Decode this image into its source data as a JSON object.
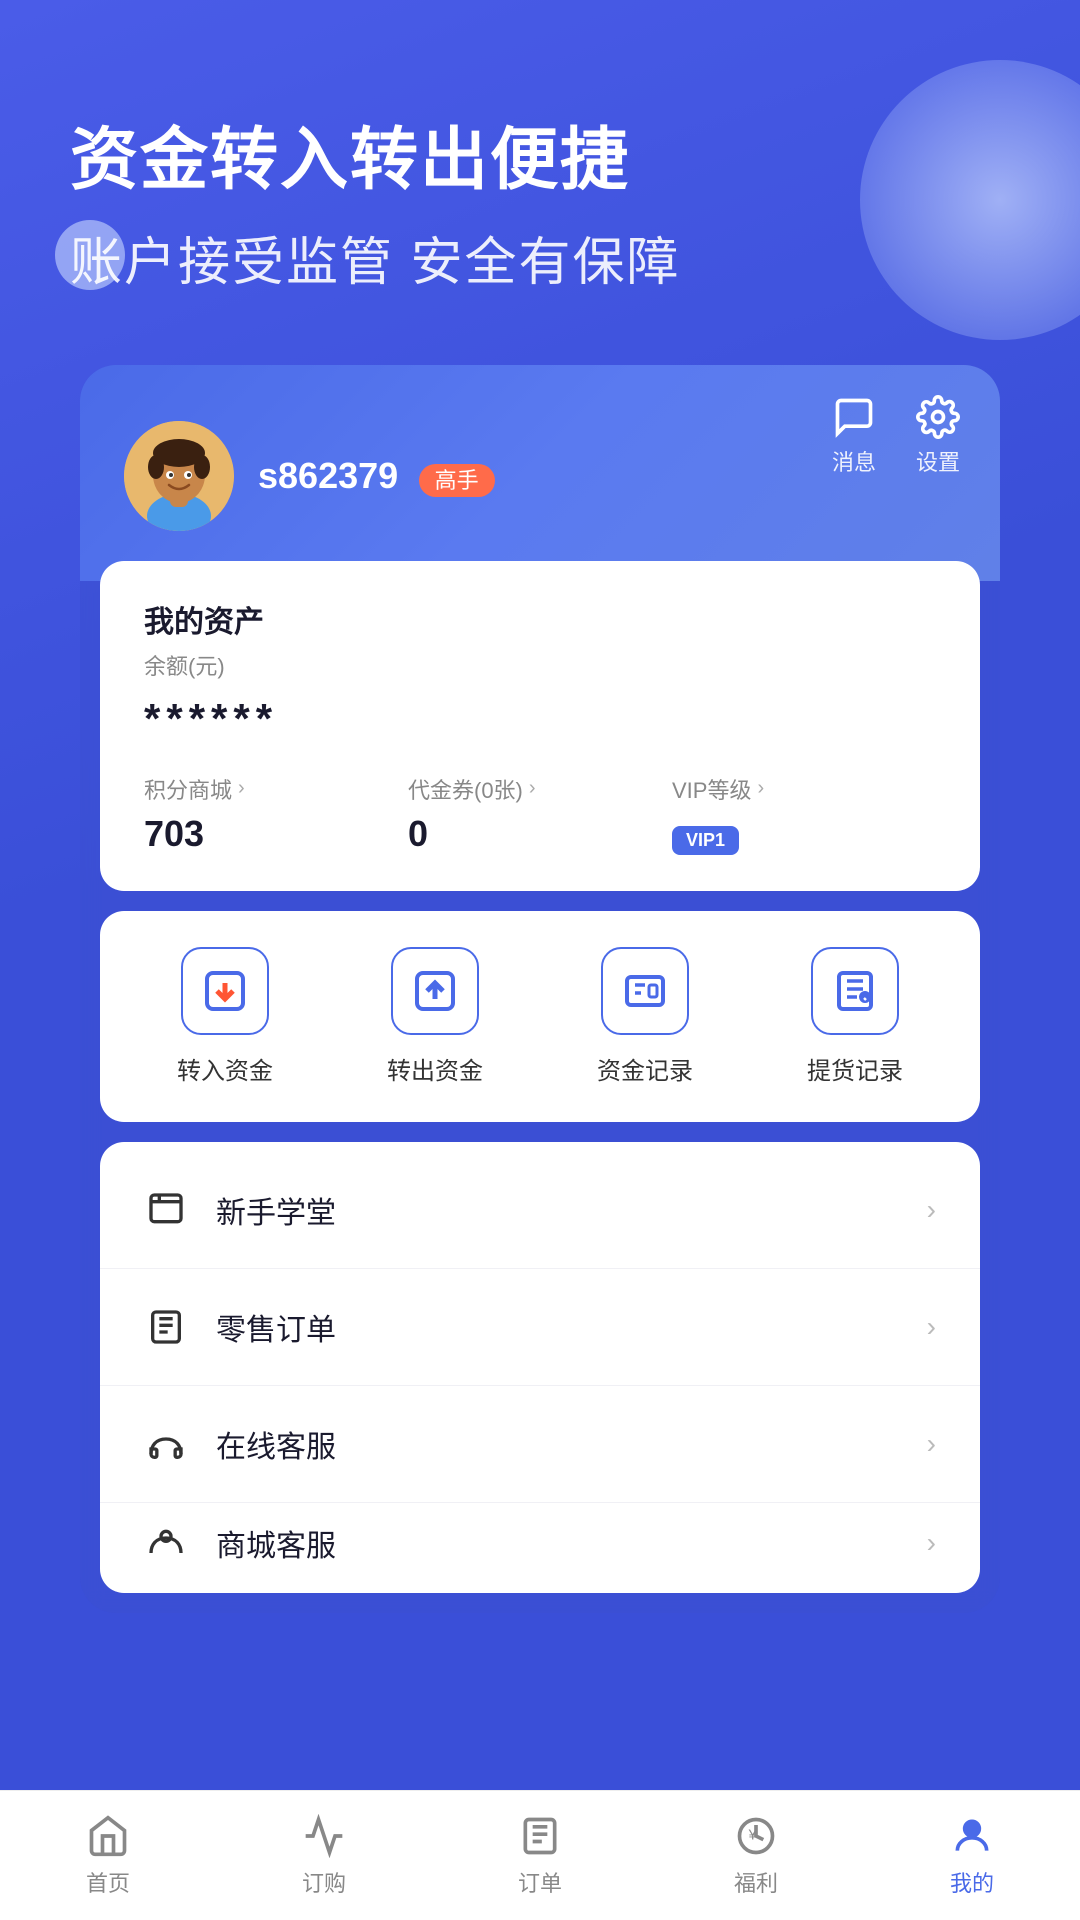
{
  "header": {
    "title_line1": "资金转入转出便捷",
    "title_line2": "账户接受监管 安全有保障"
  },
  "profile": {
    "username": "s862379",
    "level_badge": "高手",
    "message_label": "消息",
    "settings_label": "设置"
  },
  "assets": {
    "title": "我的资产",
    "balance_label": "余额(元)",
    "balance_value": "******",
    "stat1_label": "积分商城",
    "stat1_value": "703",
    "stat2_label": "代金券(0张)",
    "stat2_value": "0",
    "stat3_label": "VIP等级",
    "stat3_value": "VIP1"
  },
  "actions": [
    {
      "label": "转入资金",
      "id": "transfer-in"
    },
    {
      "label": "转出资金",
      "id": "transfer-out"
    },
    {
      "label": "资金记录",
      "id": "fund-records"
    },
    {
      "label": "提货记录",
      "id": "delivery-records"
    }
  ],
  "menu_items": [
    {
      "label": "新手学堂",
      "id": "beginner-hall"
    },
    {
      "label": "零售订单",
      "id": "retail-orders"
    },
    {
      "label": "在线客服",
      "id": "online-service"
    },
    {
      "label": "商城客服",
      "id": "mall-service"
    }
  ],
  "bottom_nav": [
    {
      "label": "首页",
      "id": "home",
      "active": false
    },
    {
      "label": "订购",
      "id": "order",
      "active": false
    },
    {
      "label": "订单",
      "id": "orders",
      "active": false
    },
    {
      "label": "福利",
      "id": "benefits",
      "active": false
    },
    {
      "label": "我的",
      "id": "mine",
      "active": true
    }
  ],
  "colors": {
    "primary": "#4a6ae8",
    "accent": "#ff6b4a",
    "bg": "#3a4fd8"
  }
}
